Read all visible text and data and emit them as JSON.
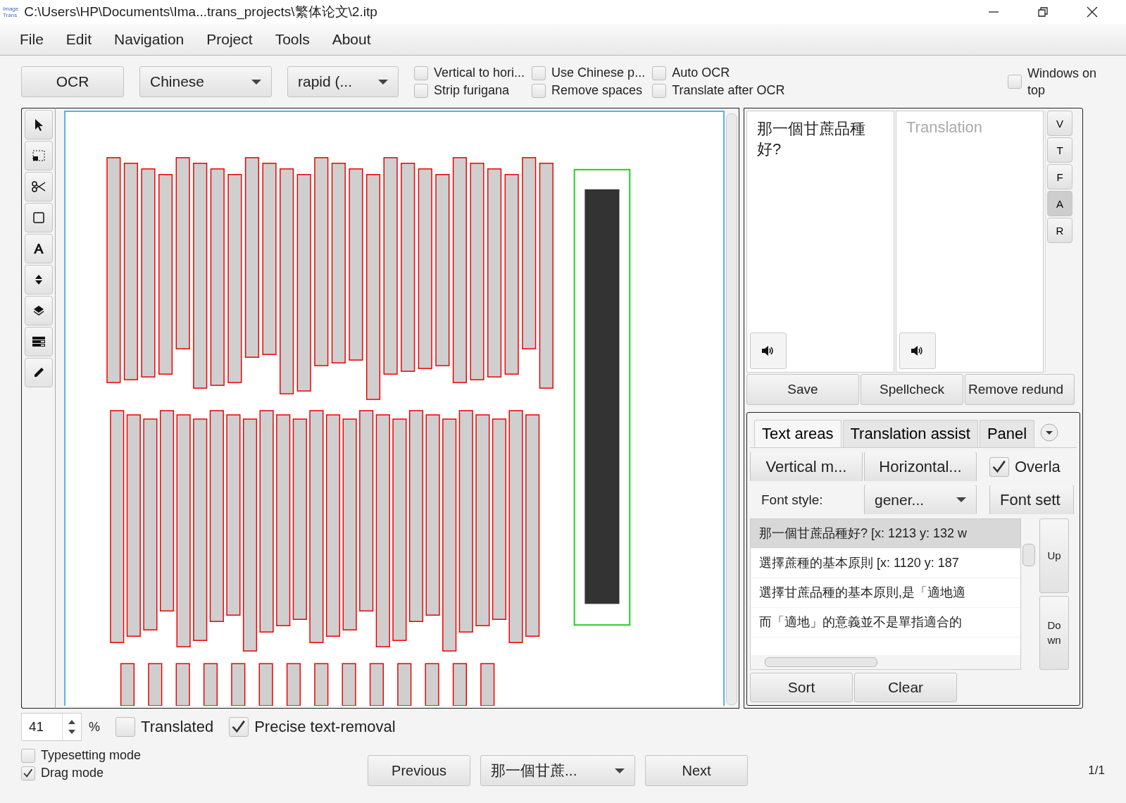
{
  "window": {
    "app_logo": [
      "Image",
      "Trans"
    ],
    "title": "C:\\Users\\HP\\Documents\\Ima...trans_projects\\繁体论文\\2.itp"
  },
  "menu": [
    "File",
    "Edit",
    "Navigation",
    "Project",
    "Tools",
    "About"
  ],
  "toolbar": {
    "ocr_button": "OCR",
    "language": "Chinese",
    "engine": "rapid (...",
    "checkboxes": [
      {
        "label": "Vertical to hori...",
        "checked": false
      },
      {
        "label": "Strip furigana",
        "checked": false
      },
      {
        "label": "Use Chinese p...",
        "checked": false
      },
      {
        "label": "Remove spaces",
        "checked": false
      },
      {
        "label": "Auto OCR",
        "checked": false
      },
      {
        "label": "Translate after OCR",
        "checked": false
      }
    ],
    "windows_on_top": {
      "label": "Windows on top",
      "checked": false
    }
  },
  "tools": [
    {
      "kind": "pointer",
      "selected": false
    },
    {
      "kind": "select",
      "selected": false
    },
    {
      "kind": "cut",
      "selected": false
    },
    {
      "kind": "rect",
      "selected": false
    },
    {
      "kind": "text",
      "selected": false
    },
    {
      "kind": "updown",
      "selected": false
    },
    {
      "kind": "layers",
      "selected": false
    },
    {
      "kind": "list",
      "selected": false
    },
    {
      "kind": "pen",
      "selected": false
    }
  ],
  "editor": {
    "source_text": "那一個甘蔗品種好?",
    "translation_placeholder": "Translation",
    "side_buttons": [
      {
        "label": "V",
        "selected": false
      },
      {
        "label": "T",
        "selected": false
      },
      {
        "label": "F",
        "selected": false
      },
      {
        "label": "A",
        "selected": true
      },
      {
        "label": "R",
        "selected": false
      }
    ],
    "buttons": [
      "Save",
      "Spellcheck",
      "Remove redund"
    ]
  },
  "panel": {
    "tabs": [
      {
        "label": "Text areas",
        "selected": true
      },
      {
        "label": "Translation assist",
        "selected": false
      },
      {
        "label": "Panel",
        "selected": false
      }
    ],
    "vertical_button": "Vertical m...",
    "horizontal_button": "Horizontal...",
    "overlay": {
      "label": "Overla",
      "checked": true
    },
    "font_style_label": "Font style:",
    "font_style": "gener...",
    "font_settings_button": "Font sett",
    "areas": [
      {
        "text": "那一個甘蔗品種好? [x: 1213 y: 132 w",
        "selected": true
      },
      {
        "text": "選擇蔗種的基本原則 [x: 1120 y: 187",
        "selected": false
      },
      {
        "text": "選擇甘蔗品種的基本原則,是「適地適",
        "selected": false
      },
      {
        "text": "而「適地」的意義並不是單指適合的",
        "selected": false
      }
    ],
    "up_button": "Up",
    "down_button": "Down",
    "bottom_buttons": [
      "Sort",
      "Clear"
    ]
  },
  "footer": {
    "zoom": "41",
    "percent": "%",
    "translated": {
      "label": "Translated",
      "checked": false
    },
    "precise": {
      "label": "Precise text-removal",
      "checked": true
    },
    "typesetting": {
      "label": "Typesetting mode",
      "checked": false
    },
    "drag": {
      "label": "Drag mode",
      "checked": true
    },
    "previous": "Previous",
    "page_select": "那一個甘蔗...",
    "next": "Next",
    "page_count": "1/1"
  }
}
